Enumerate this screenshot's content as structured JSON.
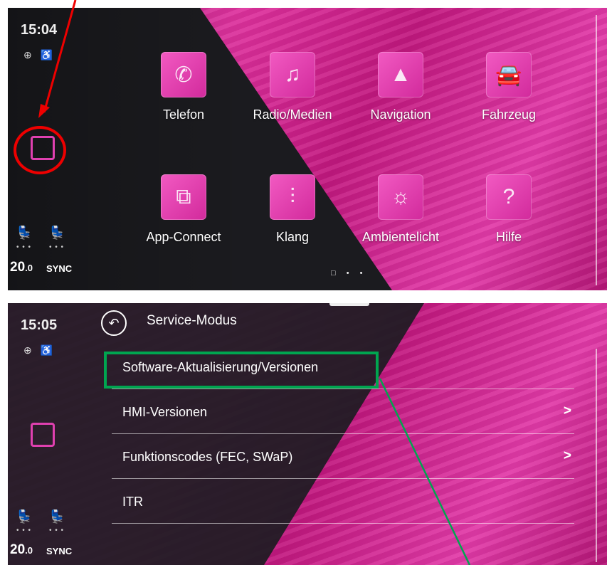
{
  "top_screen": {
    "clock": "15:04",
    "status_icons": "⊕ ♿",
    "temperature": "20",
    "temperature_decimal": ".0",
    "sync_label": "SYNC",
    "apps": [
      {
        "label": "Telefon",
        "icon": "phone-icon",
        "glyph": "✆"
      },
      {
        "label": "Radio/Medien",
        "icon": "music-note-icon",
        "glyph": "♫"
      },
      {
        "label": "Navigation",
        "icon": "navigation-arrow-icon",
        "glyph": "▲"
      },
      {
        "label": "Fahrzeug",
        "icon": "car-icon",
        "glyph": "🚘"
      },
      {
        "label": "App-Connect",
        "icon": "app-connect-icon",
        "glyph": "⧉"
      },
      {
        "label": "Klang",
        "icon": "equalizer-icon",
        "glyph": "⫶"
      },
      {
        "label": "Ambientelicht",
        "icon": "light-bulb-icon",
        "glyph": "☼"
      },
      {
        "label": "Hilfe",
        "icon": "help-icon",
        "glyph": "?"
      }
    ],
    "pager": "□ • •"
  },
  "bottom_screen": {
    "clock": "15:05",
    "status_icons": "⊕ ♿",
    "temperature": "20",
    "temperature_decimal": ".0",
    "sync_label": "SYNC",
    "title": "Service-Modus",
    "menu_items": [
      {
        "label": "Software-Aktualisierung/Versionen",
        "chevron": ""
      },
      {
        "label": "HMI-Versionen",
        "chevron": ">"
      },
      {
        "label": "Funktionscodes (FEC, SWaP)",
        "chevron": ">"
      },
      {
        "label": "ITR",
        "chevron": ""
      }
    ]
  },
  "colors": {
    "accent_magenta": "#e0329f",
    "annotation_red": "#ee0000",
    "annotation_green": "#00a550"
  }
}
